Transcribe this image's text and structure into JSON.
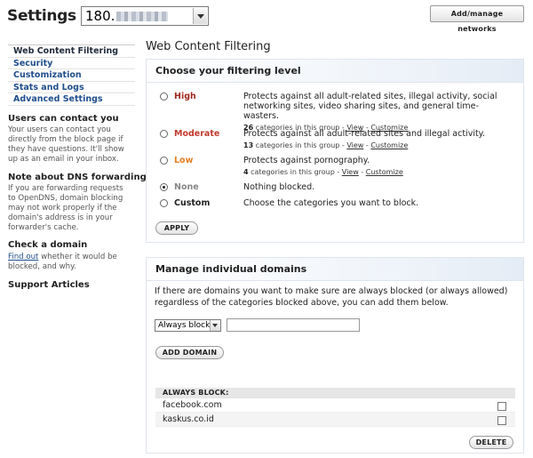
{
  "header": {
    "title": "Settings for:",
    "network_prefix": "180.",
    "add_networks_label": "Add/manage networks"
  },
  "sidebar": {
    "items": [
      {
        "label": "Web Content Filtering",
        "active": true
      },
      {
        "label": "Security"
      },
      {
        "label": "Customization"
      },
      {
        "label": "Stats and Logs"
      },
      {
        "label": "Advanced Settings"
      }
    ],
    "contact_title": "Users can contact you",
    "contact_text": "Your users can contact you directly from the block page if they have questions. It'll show up as an email in your inbox.",
    "dns_title": "Note about DNS forwarding",
    "dns_text": "If you are forwarding requests to OpenDNS, domain blocking may not work properly if the domain's address is in your forwarder's cache.",
    "check_title": "Check a domain",
    "check_link": "Find out",
    "check_text": " whether it would be blocked, and why.",
    "support_title": "Support Articles"
  },
  "main": {
    "title": "Web Content Filtering",
    "filter": {
      "heading": "Choose your filtering level",
      "levels": [
        {
          "name": "High",
          "color": "#a0291f",
          "desc": "Protects against all adult-related sites, illegal activity, social networking sites, video sharing sites, and general time-wasters.",
          "count": "26",
          "meta": " categories in this group - ",
          "view": "View",
          "sep": " - ",
          "customize": "Customize"
        },
        {
          "name": "Moderate",
          "color": "#c0392b",
          "desc": "Protects against all adult-related sites and illegal activity.",
          "count": "13",
          "meta": " categories in this group - ",
          "view": "View",
          "sep": " - ",
          "customize": "Customize"
        },
        {
          "name": "Low",
          "color": "#e67e22",
          "desc": "Protects against pornography.",
          "count": "4",
          "meta": " categories in this group - ",
          "view": "View",
          "sep": " - ",
          "customize": "Customize"
        },
        {
          "name": "None",
          "color": "#888888",
          "desc": "Nothing blocked.",
          "selected": true
        },
        {
          "name": "Custom",
          "color": "#222222",
          "desc": "Choose the categories you want to block."
        }
      ],
      "apply_label": "APPLY"
    },
    "domains": {
      "heading": "Manage individual domains",
      "description": "If there are domains you want to make sure are always blocked (or always allowed) regardless of the categories blocked above, you can add them below.",
      "mode_selected": "Always block",
      "domain_input_value": "",
      "add_label": "ADD DOMAIN",
      "list_heading": "ALWAYS BLOCK:",
      "blocked": [
        "facebook.com",
        "kaskus.co.id"
      ],
      "delete_label": "DELETE"
    }
  }
}
